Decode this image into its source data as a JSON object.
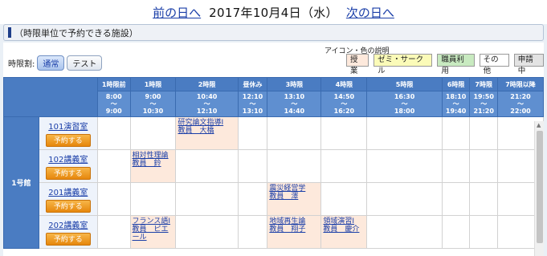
{
  "nav": {
    "prev_label": "前の日へ",
    "date": "2017年10月4日（水）",
    "next_label": "次の日へ"
  },
  "section": {
    "title": "（時限単位で予約できる施設）"
  },
  "jigen": {
    "label": "時限割:",
    "options": [
      "通常",
      "テスト"
    ],
    "selected": "通常"
  },
  "legend": {
    "title": "アイコン・色の説明",
    "items": [
      {
        "label": "授業",
        "color": "#fde9dc"
      },
      {
        "label": "ゼミ・サークル",
        "color": "#fbfbb8"
      },
      {
        "label": "職員利用",
        "color": "#c8eac0"
      },
      {
        "label": "その他",
        "color": "#ffffff"
      },
      {
        "label": "申請中",
        "color": "#e3e3e3"
      }
    ]
  },
  "periods": [
    {
      "name": "1時限前",
      "start": "8:00",
      "end": "9:00"
    },
    {
      "name": "1時限",
      "start": "9:00",
      "end": "10:30"
    },
    {
      "name": "2時限",
      "start": "10:40",
      "end": "12:10"
    },
    {
      "name": "昼休み",
      "start": "12:10",
      "end": "13:10"
    },
    {
      "name": "3時限",
      "start": "13:10",
      "end": "14:40"
    },
    {
      "name": "4時限",
      "start": "14:50",
      "end": "16:20"
    },
    {
      "name": "5時限",
      "start": "16:30",
      "end": "18:00"
    },
    {
      "name": "6時限",
      "start": "18:10",
      "end": "19:40"
    },
    {
      "name": "7時限",
      "start": "19:50",
      "end": "21:20"
    },
    {
      "name": "7時限以降",
      "start": "21:20",
      "end": "22:00"
    }
  ],
  "tilde": "〜",
  "building": "1号館",
  "reserve_label": "予約する",
  "rooms": [
    {
      "name": "101演習室",
      "lectures": {
        "2時限": {
          "line1": "研究論文指導Ⅰ",
          "line2": "教員　大橋"
        }
      }
    },
    {
      "name": "102講義室",
      "lectures": {
        "1時限": {
          "line1": "相対性理論",
          "line2": "教員　鈴"
        }
      }
    },
    {
      "name": "201講義室",
      "lectures": {
        "3時限": {
          "line1": "震災経営学",
          "line2": "教員　澤"
        }
      }
    },
    {
      "name": "202講義室",
      "lectures": {
        "1時限": {
          "line1": "フランス語Ⅰ",
          "line2": "教員　ピエール"
        },
        "3時限": {
          "line1": "地域再生論",
          "line2": "教員　翔子"
        },
        "4時限": {
          "line1": "領域演習Ⅰ",
          "line2": "教員　慶介"
        }
      }
    }
  ]
}
